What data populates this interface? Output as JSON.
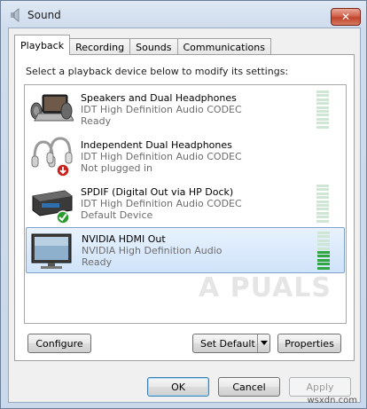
{
  "window": {
    "title": "Sound",
    "close_label": "✕"
  },
  "tabs": [
    {
      "label": "Playback",
      "active": true
    },
    {
      "label": "Recording",
      "active": false
    },
    {
      "label": "Sounds",
      "active": false
    },
    {
      "label": "Communications",
      "active": false
    }
  ],
  "instruction": "Select a playback device below to modify its settings:",
  "devices": [
    {
      "name": "Speakers and Dual Headphones",
      "driver": "IDT High Definition Audio CODEC",
      "status": "Ready",
      "icon": "laptop-speakers-icon",
      "meter_active_levels": 0,
      "selected": false
    },
    {
      "name": "Independent Dual Headphones",
      "driver": "IDT High Definition Audio CODEC",
      "status": "Not plugged in",
      "icon": "headphones-icon",
      "selected": false
    },
    {
      "name": "SPDIF (Digital Out via HP Dock)",
      "driver": "IDT High Definition Audio CODEC",
      "status": "Default Device",
      "icon": "spdif-dock-icon",
      "meter_active_levels": 0,
      "selected": false
    },
    {
      "name": "NVIDIA HDMI Out",
      "driver": "NVIDIA High Definition Audio",
      "status": "Ready",
      "icon": "monitor-icon",
      "meter_active_levels": 5,
      "selected": true
    }
  ],
  "buttons": {
    "configure": "Configure",
    "set_default": "Set Default",
    "properties": "Properties",
    "ok": "OK",
    "cancel": "Cancel",
    "apply": "Apply"
  },
  "watermark": "A  PUALS",
  "site": "wsxdn.com",
  "colors": {
    "meter_off": "#cfe6d4",
    "meter_on": "#2fa640",
    "selection": "#cfe3fa"
  }
}
